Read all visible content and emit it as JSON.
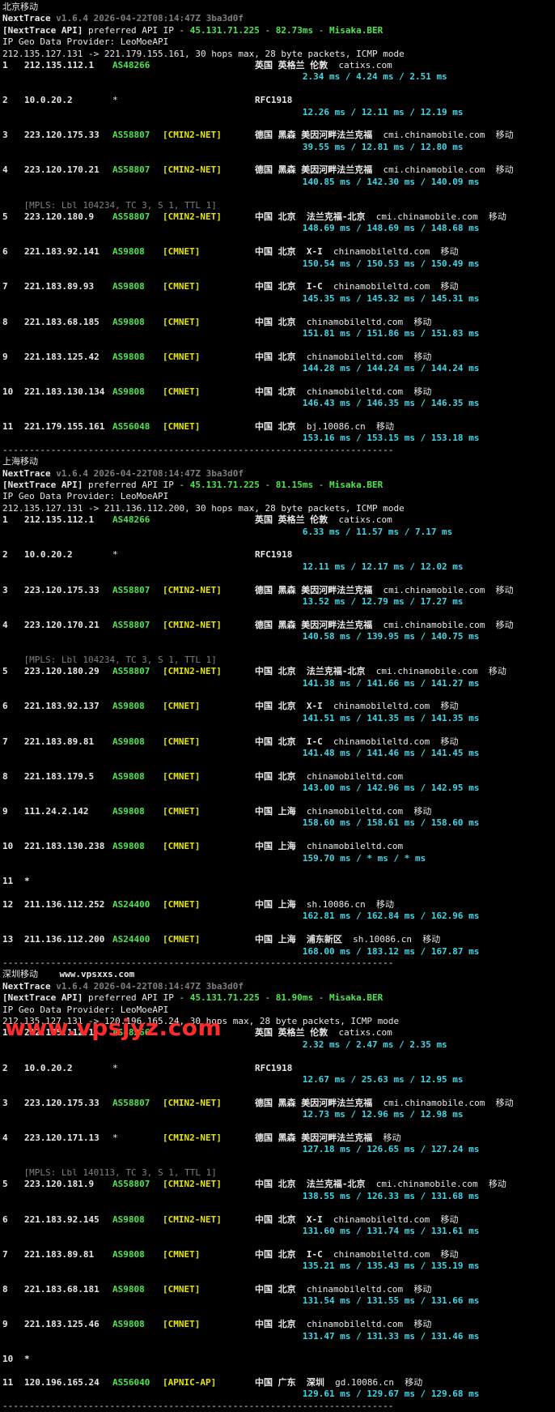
{
  "sections": [
    {
      "title": "北京移动",
      "version_line": "NextTrace v1.6.4 2026-04-22T08:14:47Z 3ba3d0f",
      "api_prefix": "[NextTrace API]",
      "api_text": " preferred API IP - ",
      "api_ip": "45.131.71.225",
      "api_sep": " - ",
      "api_ms": "82.73ms",
      "api_sep2": " - ",
      "api_node": "Misaka.BER",
      "geo_provider": "IP Geo Data Provider: LeoMoeAPI",
      "route_line": "212.135.127.131 -> 221.179.155.161, 30 hops max, 28 byte packets, ICMP mode",
      "hops": [
        {
          "n": "1",
          "ip": "212.135.112.1",
          "asn": "AS48266",
          "tag": "",
          "geo": "英国 英格兰 伦敦",
          "host": "catixs.com",
          "isp": "",
          "rtt": "2.34 ms / 4.24 ms / 2.51 ms"
        },
        {
          "n": "2",
          "ip": "10.0.20.2",
          "asn": "*",
          "tag": "",
          "geo": "RFC1918",
          "host": "",
          "isp": "",
          "rtt": "12.26 ms / 12.11 ms / 12.19 ms"
        },
        {
          "n": "3",
          "ip": "223.120.175.33",
          "asn": "AS58807",
          "tag": "[CMIN2-NET]",
          "geo": "德国 黑森 美因河畔法兰克福",
          "host": "cmi.chinamobile.com",
          "isp": "移动",
          "rtt": "39.55 ms / 12.81 ms / 12.80 ms"
        },
        {
          "n": "4",
          "ip": "223.120.170.21",
          "asn": "AS58807",
          "tag": "[CMIN2-NET]",
          "geo": "德国 黑森 美因河畔法兰克福",
          "host": "cmi.chinamobile.com",
          "isp": "移动",
          "rtt": "140.85 ms / 142.30 ms / 140.09 ms"
        },
        {
          "mpls": "    [MPLS: Lbl 104234, TC 3, S 1, TTL 1]"
        },
        {
          "n": "5",
          "ip": "223.120.180.9",
          "asn": "AS58807",
          "tag": "[CMIN2-NET]",
          "geo": "中国 北京  法兰克福-北京",
          "host": "cmi.chinamobile.com",
          "isp": "移动",
          "rtt": "148.69 ms / 148.69 ms / 148.68 ms"
        },
        {
          "n": "6",
          "ip": "221.183.92.141",
          "asn": "AS9808",
          "tag": "[CMNET]",
          "geo": "中国 北京  X-I",
          "host": "chinamobileltd.com",
          "isp": "移动",
          "rtt": "150.54 ms / 150.53 ms / 150.49 ms"
        },
        {
          "n": "7",
          "ip": "221.183.89.93",
          "asn": "AS9808",
          "tag": "[CMNET]",
          "geo": "中国 北京  I-C",
          "host": "chinamobileltd.com",
          "isp": "移动",
          "rtt": "145.35 ms / 145.32 ms / 145.31 ms"
        },
        {
          "n": "8",
          "ip": "221.183.68.185",
          "asn": "AS9808",
          "tag": "[CMNET]",
          "geo": "中国 北京",
          "host": "chinamobileltd.com",
          "isp": "移动",
          "rtt": "151.81 ms / 151.86 ms / 151.83 ms"
        },
        {
          "n": "9",
          "ip": "221.183.125.42",
          "asn": "AS9808",
          "tag": "[CMNET]",
          "geo": "中国 北京",
          "host": "chinamobileltd.com",
          "isp": "移动",
          "rtt": "144.28 ms / 144.24 ms / 144.24 ms"
        },
        {
          "n": "10",
          "ip": "221.183.130.134",
          "asn": "AS9808",
          "tag": "[CMNET]",
          "geo": "中国 北京",
          "host": "chinamobileltd.com",
          "isp": "移动",
          "rtt": "146.43 ms / 146.35 ms / 146.35 ms"
        },
        {
          "n": "11",
          "ip": "221.179.155.161",
          "asn": "AS56048",
          "tag": "[CMNET]",
          "geo": "中国 北京",
          "host": "bj.10086.cn",
          "isp": "移动",
          "rtt": "153.16 ms / 153.15 ms / 153.18 ms"
        }
      ]
    },
    {
      "title": "上海移动",
      "version_line": "NextTrace v1.6.4 2026-04-22T08:14:47Z 3ba3d0f",
      "api_prefix": "[NextTrace API]",
      "api_text": " preferred API IP - ",
      "api_ip": "45.131.71.225",
      "api_sep": " - ",
      "api_ms": "81.15ms",
      "api_sep2": " - ",
      "api_node": "Misaka.BER",
      "geo_provider": "IP Geo Data Provider: LeoMoeAPI",
      "route_line": "212.135.127.131 -> 211.136.112.200, 30 hops max, 28 byte packets, ICMP mode",
      "hops": [
        {
          "n": "1",
          "ip": "212.135.112.1",
          "asn": "AS48266",
          "tag": "",
          "geo": "英国 英格兰 伦敦",
          "host": "catixs.com",
          "isp": "",
          "rtt": "6.33 ms / 11.57 ms / 7.17 ms"
        },
        {
          "n": "2",
          "ip": "10.0.20.2",
          "asn": "*",
          "tag": "",
          "geo": "RFC1918",
          "host": "",
          "isp": "",
          "rtt": "12.11 ms / 12.17 ms / 12.02 ms"
        },
        {
          "n": "3",
          "ip": "223.120.175.33",
          "asn": "AS58807",
          "tag": "[CMIN2-NET]",
          "geo": "德国 黑森 美因河畔法兰克福",
          "host": "cmi.chinamobile.com",
          "isp": "移动",
          "rtt": "13.52 ms / 12.79 ms / 17.27 ms"
        },
        {
          "n": "4",
          "ip": "223.120.170.21",
          "asn": "AS58807",
          "tag": "[CMIN2-NET]",
          "geo": "德国 黑森 美因河畔法兰克福",
          "host": "cmi.chinamobile.com",
          "isp": "移动",
          "rtt": "140.58 ms / 139.95 ms / 140.75 ms"
        },
        {
          "mpls": "    [MPLS: Lbl 104234, TC 3, S 1, TTL 1]"
        },
        {
          "n": "5",
          "ip": "223.120.180.29",
          "asn": "AS58807",
          "tag": "[CMIN2-NET]",
          "geo": "中国 北京  法兰克福-北京",
          "host": "cmi.chinamobile.com",
          "isp": "移动",
          "rtt": "141.38 ms / 141.66 ms / 141.27 ms"
        },
        {
          "n": "6",
          "ip": "221.183.92.137",
          "asn": "AS9808",
          "tag": "[CMNET]",
          "geo": "中国 北京  X-I",
          "host": "chinamobileltd.com",
          "isp": "移动",
          "rtt": "141.51 ms / 141.35 ms / 141.35 ms"
        },
        {
          "n": "7",
          "ip": "221.183.89.81",
          "asn": "AS9808",
          "tag": "[CMNET]",
          "geo": "中国 北京  I-C",
          "host": "chinamobileltd.com",
          "isp": "移动",
          "rtt": "141.48 ms / 141.46 ms / 141.45 ms"
        },
        {
          "n": "8",
          "ip": "221.183.179.5",
          "asn": "AS9808",
          "tag": "[CMNET]",
          "geo": "中国 北京",
          "host": "chinamobileltd.com",
          "isp": "",
          "rtt": "143.00 ms / 142.96 ms / 142.95 ms"
        },
        {
          "n": "9",
          "ip": "111.24.2.142",
          "asn": "AS9808",
          "tag": "[CMNET]",
          "geo": "中国 上海",
          "host": "chinamobileltd.com",
          "isp": "移动",
          "rtt": "158.60 ms / 158.61 ms / 158.60 ms"
        },
        {
          "n": "10",
          "ip": "221.183.130.238",
          "asn": "AS9808",
          "tag": "[CMNET]",
          "geo": "中国 上海",
          "host": "chinamobileltd.com",
          "isp": "",
          "rtt": "159.70 ms / * ms / * ms"
        },
        {
          "n": "11",
          "ip": "*",
          "asn": "",
          "tag": "",
          "geo": "",
          "host": "",
          "isp": "",
          "rtt": ""
        },
        {
          "n": "12",
          "ip": "211.136.112.252",
          "asn": "AS24400",
          "tag": "[CMNET]",
          "geo": "中国 上海",
          "host": "sh.10086.cn",
          "isp": "移动",
          "rtt": "162.81 ms / 162.84 ms / 162.96 ms"
        },
        {
          "n": "13",
          "ip": "211.136.112.200",
          "asn": "AS24400",
          "tag": "[CMNET]",
          "geo": "中国 上海  浦东新区",
          "host": "sh.10086.cn",
          "isp": "移动",
          "rtt": "168.00 ms / 183.12 ms / 167.87 ms"
        }
      ]
    },
    {
      "title": "深圳移动",
      "title_extra": "www.vpsxxs.com",
      "version_line": "NextTrace v1.6.4 2026-04-22T08:14:47Z 3ba3d0f",
      "api_prefix": "[NextTrace API]",
      "api_text": " preferred API IP - ",
      "api_ip": "45.131.71.225",
      "api_sep": " - ",
      "api_ms": "81.90ms",
      "api_sep2": " - ",
      "api_node": "Misaka.BER",
      "geo_provider": "IP Geo Data Provider: LeoMoeAPI",
      "route_line": "212.135.127.131 -> 120.196.165.24, 30 hops max, 28 byte packets, ICMP mode",
      "hops": [
        {
          "n": "1",
          "ip": "212.135.112.1",
          "asn": "AS48266",
          "tag": "",
          "geo": "英国 英格兰 伦敦",
          "host": "catixs.com",
          "isp": "",
          "rtt": "2.32 ms / 2.47 ms / 2.35 ms"
        },
        {
          "n": "2",
          "ip": "10.0.20.2",
          "asn": "*",
          "tag": "",
          "geo": "RFC1918",
          "host": "",
          "isp": "",
          "rtt": "12.67 ms / 25.63 ms / 12.95 ms"
        },
        {
          "n": "3",
          "ip": "223.120.175.33",
          "asn": "AS58807",
          "tag": "[CMIN2-NET]",
          "geo": "德国 黑森 美因河畔法兰克福",
          "host": "cmi.chinamobile.com",
          "isp": "移动",
          "rtt": "12.73 ms / 12.96 ms / 12.98 ms"
        },
        {
          "n": "4",
          "ip": "223.120.171.13",
          "asn": "*",
          "tag": "[CMIN2-NET]",
          "geo": "德国 黑森 美因河畔法兰克福",
          "host": "",
          "isp": "移动",
          "rtt": "127.18 ms / 126.65 ms / 127.24 ms"
        },
        {
          "mpls": "    [MPLS: Lbl 140113, TC 3, S 1, TTL 1]"
        },
        {
          "n": "5",
          "ip": "223.120.181.9",
          "asn": "AS58807",
          "tag": "[CMIN2-NET]",
          "geo": "中国 北京  法兰克福-北京",
          "host": "cmi.chinamobile.com",
          "isp": "移动",
          "rtt": "138.55 ms / 126.33 ms / 131.68 ms"
        },
        {
          "n": "6",
          "ip": "221.183.92.145",
          "asn": "AS9808",
          "tag": "[CMIN2-NET]",
          "geo": "中国 北京  X-I",
          "host": "chinamobileltd.com",
          "isp": "移动",
          "rtt": "131.60 ms / 131.74 ms / 131.61 ms"
        },
        {
          "n": "7",
          "ip": "221.183.89.81",
          "asn": "AS9808",
          "tag": "[CMNET]",
          "geo": "中国 北京  I-C",
          "host": "chinamobileltd.com",
          "isp": "移动",
          "rtt": "135.21 ms / 135.43 ms / 135.19 ms"
        },
        {
          "n": "8",
          "ip": "221.183.68.181",
          "asn": "AS9808",
          "tag": "[CMNET]",
          "geo": "中国 北京",
          "host": "chinamobileltd.com",
          "isp": "移动",
          "rtt": "131.54 ms / 131.55 ms / 131.66 ms"
        },
        {
          "n": "9",
          "ip": "221.183.125.46",
          "asn": "AS9808",
          "tag": "[CMNET]",
          "geo": "中国 北京",
          "host": "chinamobileltd.com",
          "isp": "移动",
          "rtt": "131.47 ms / 131.33 ms / 131.46 ms"
        },
        {
          "n": "10",
          "ip": "*",
          "asn": "",
          "tag": "",
          "geo": "",
          "host": "",
          "isp": "",
          "rtt": ""
        },
        {
          "n": "11",
          "ip": "120.196.165.24",
          "asn": "AS56040",
          "tag": "[APNIC-AP]",
          "geo": "中国 广东  深圳",
          "host": "gd.10086.cn",
          "isp": "移动",
          "rtt": "129.61 ms / 129.67 ms / 129.68 ms"
        }
      ]
    }
  ],
  "separator": "-------------------------------------------------------------------------",
  "watermark": "www.vpsjyz.com",
  "colors": {
    "background": "#000000",
    "asn": "#4ee64e",
    "tag": "#e5e500",
    "rtt": "#3fd6e6",
    "api_ip": "#4ee64e",
    "watermark": "#ff2a2a"
  }
}
